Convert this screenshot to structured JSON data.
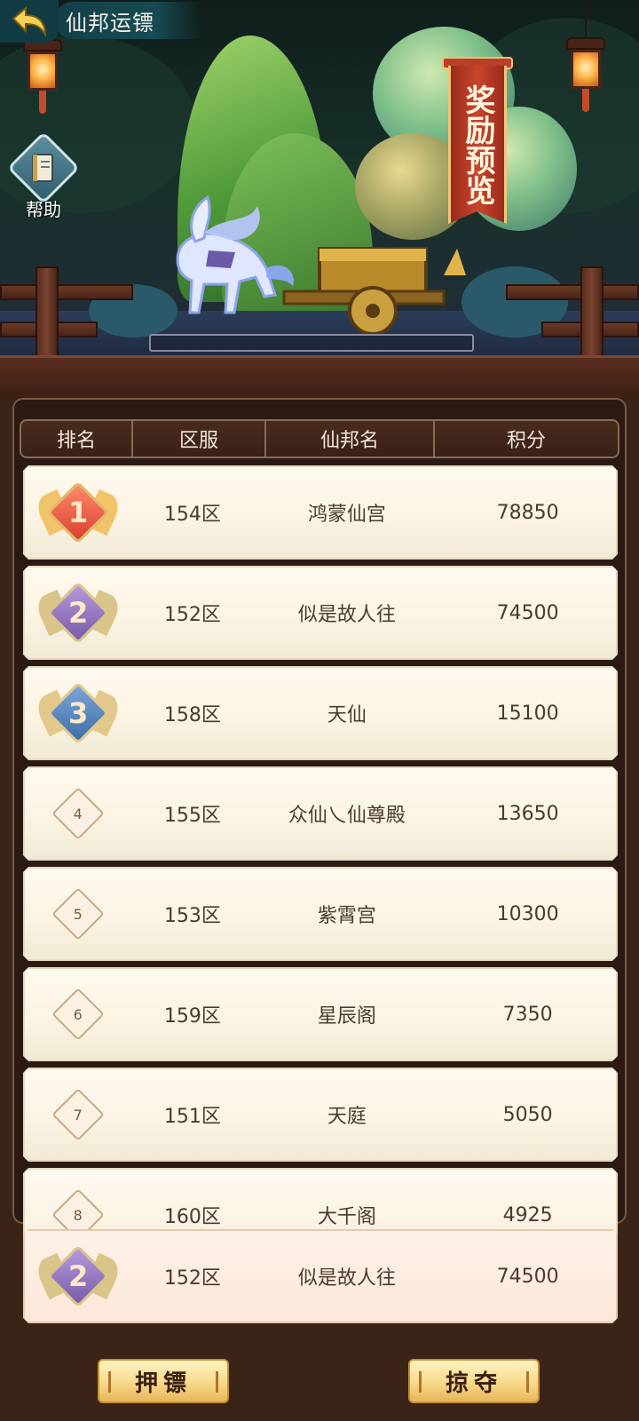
{
  "header": {
    "title": "仙邦运镖",
    "back_icon": "back-arrow-icon"
  },
  "help": {
    "label": "帮助",
    "icon": "book-icon"
  },
  "reward_banner": {
    "label": "奖励预览"
  },
  "escort_progress": {
    "value": 0
  },
  "table": {
    "columns": [
      "排名",
      "区服",
      "仙邦名",
      "积分"
    ],
    "rows": [
      {
        "rank": "1",
        "server": "154区",
        "name": "鸿蒙仙宫",
        "score": "78850"
      },
      {
        "rank": "2",
        "server": "152区",
        "name": "似是故人往",
        "score": "74500"
      },
      {
        "rank": "3",
        "server": "158区",
        "name": "天仙",
        "score": "15100"
      },
      {
        "rank": "4",
        "server": "155区",
        "name": "众仙乀仙尊殿",
        "score": "13650"
      },
      {
        "rank": "5",
        "server": "153区",
        "name": "紫霄宫",
        "score": "10300"
      },
      {
        "rank": "6",
        "server": "159区",
        "name": "星辰阁",
        "score": "7350"
      },
      {
        "rank": "7",
        "server": "151区",
        "name": "天庭",
        "score": "5050"
      },
      {
        "rank": "8",
        "server": "160区",
        "name": "大千阁",
        "score": "4925"
      }
    ]
  },
  "my_rank": {
    "rank": "2",
    "server": "152区",
    "name": "似是故人往",
    "score": "74500"
  },
  "buttons": {
    "escort": "押镖",
    "rob": "掠夺"
  },
  "colors": {
    "rank1": "#d8402e",
    "rank2": "#7a5aa8",
    "rank3": "#3f6ea6",
    "button": "#f7d98a",
    "panel": "#2b1a14"
  }
}
